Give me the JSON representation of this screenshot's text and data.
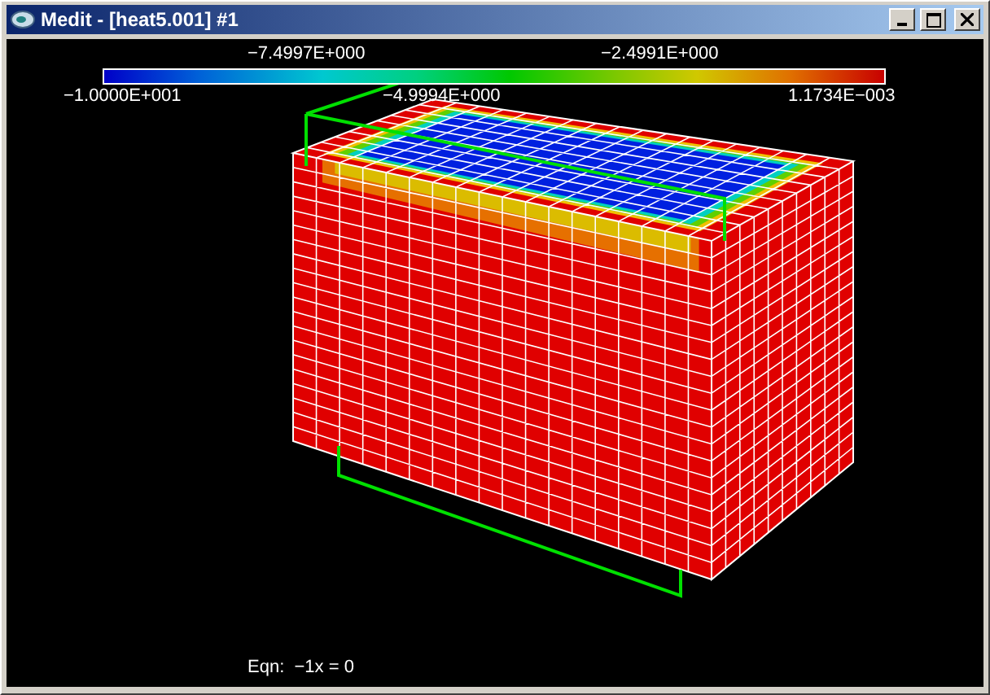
{
  "window": {
    "title": "Medit - [heat5.001] #1"
  },
  "colorbar": {
    "top_labels": [
      "−7.4997E+000",
      "−2.4991E+000"
    ],
    "bottom_labels": [
      "−1.0000E+001",
      "−4.9994E+000",
      "1.1734E−003"
    ]
  },
  "equation": "Eqn:  −1x = 0"
}
